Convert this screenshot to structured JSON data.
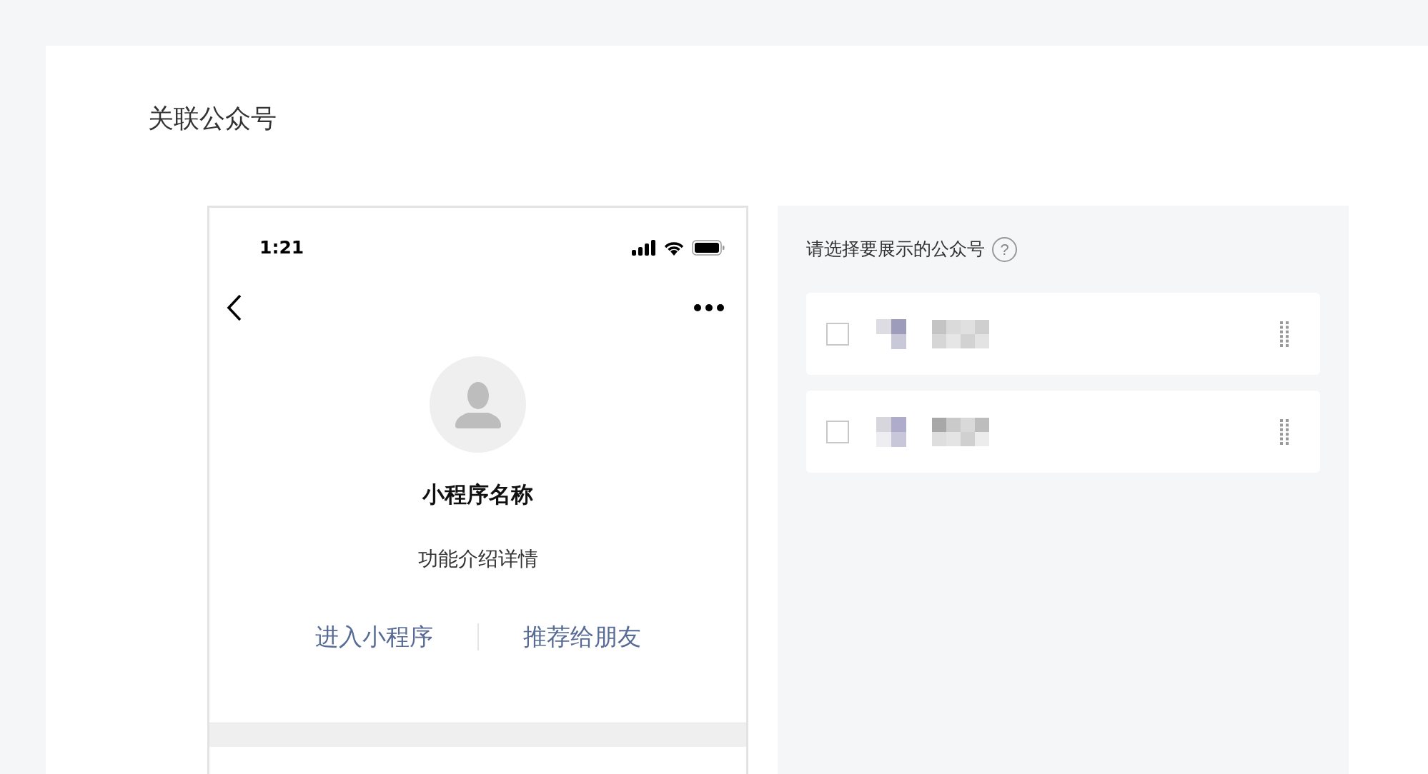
{
  "page_title": "关联公众号",
  "preview": {
    "status_time": "1:21",
    "app_name": "小程序名称",
    "description": "功能介绍详情",
    "actions": [
      {
        "label": "进入小程序"
      },
      {
        "label": "推荐给朋友"
      }
    ]
  },
  "account_picker": {
    "label": "请选择要展示的公众号",
    "help_icon": "?",
    "accounts": [
      {
        "checked": false
      },
      {
        "checked": false
      }
    ]
  }
}
